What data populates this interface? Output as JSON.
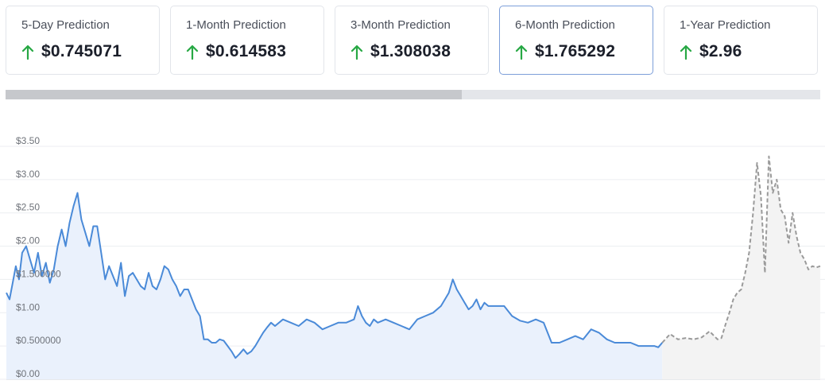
{
  "predictions": [
    {
      "label": "5-Day Prediction",
      "value": "$0.745071",
      "direction": "up",
      "selected": false
    },
    {
      "label": "1-Month Prediction",
      "value": "$0.614583",
      "direction": "up",
      "selected": false
    },
    {
      "label": "3-Month Prediction",
      "value": "$1.308038",
      "direction": "up",
      "selected": false
    },
    {
      "label": "6-Month Prediction",
      "value": "$1.765292",
      "direction": "up",
      "selected": true
    },
    {
      "label": "1-Year Prediction",
      "value": "$2.96",
      "direction": "up",
      "selected": false
    }
  ],
  "colors": {
    "arrow_up": "#27a844",
    "historical_line": "#4a8ad8",
    "historical_fill": "#eaf1fc",
    "forecast_line": "#9a9a9a",
    "forecast_fill": "#f3f3f3",
    "selected_border": "#7d9fd9",
    "grid": "#eceef1"
  },
  "scroll_position": 0.56,
  "chart_data": {
    "type": "area",
    "ylim": [
      0,
      3.5
    ],
    "yticks": [
      {
        "value": 0,
        "label": "$0.00"
      },
      {
        "value": 0.5,
        "label": "$0.500000"
      },
      {
        "value": 1.0,
        "label": "$1.00"
      },
      {
        "value": 1.5,
        "label": "$1.500000"
      },
      {
        "value": 2.0,
        "label": "$2.00"
      },
      {
        "value": 2.5,
        "label": "$2.50"
      },
      {
        "value": 3.0,
        "label": "$3.00"
      },
      {
        "value": 3.5,
        "label": "$3.50"
      }
    ],
    "grid": true,
    "series": [
      {
        "style": "solid",
        "x": [
          0,
          4,
          8,
          12,
          16,
          20,
          25,
          30,
          35,
          40,
          45,
          50,
          55,
          60,
          65,
          70,
          75,
          80,
          85,
          90,
          95,
          100,
          105,
          110,
          115,
          120,
          125,
          130,
          135,
          140,
          145,
          150,
          155,
          160,
          165,
          170,
          175,
          180,
          185,
          190,
          195,
          200,
          205,
          210,
          215,
          220,
          225,
          230,
          235,
          240,
          245,
          250,
          255,
          260,
          265,
          270,
          275,
          280,
          285,
          290,
          295,
          300,
          305,
          310,
          315,
          320,
          325,
          330,
          335,
          340,
          350,
          360,
          370,
          380,
          390,
          400,
          410,
          420,
          430,
          440,
          445,
          450,
          455,
          460,
          465,
          470,
          480,
          490,
          500,
          510,
          520,
          530,
          540,
          550,
          555,
          560,
          565,
          570,
          575,
          580,
          585,
          590,
          595,
          600,
          605,
          610,
          620,
          630,
          640,
          650,
          660,
          670,
          680,
          690,
          700,
          710,
          720,
          730,
          740,
          750,
          760,
          770,
          780,
          790,
          800,
          810,
          820,
          825,
          830
        ],
        "y": [
          1.3,
          1.2,
          1.45,
          1.7,
          1.5,
          1.9,
          2.0,
          1.8,
          1.6,
          1.9,
          1.55,
          1.75,
          1.45,
          1.65,
          2.0,
          2.25,
          2.0,
          2.35,
          2.6,
          2.8,
          2.4,
          2.2,
          2.0,
          2.3,
          2.3,
          1.9,
          1.5,
          1.7,
          1.55,
          1.4,
          1.75,
          1.25,
          1.55,
          1.6,
          1.5,
          1.4,
          1.35,
          1.6,
          1.4,
          1.35,
          1.5,
          1.7,
          1.65,
          1.5,
          1.4,
          1.25,
          1.35,
          1.35,
          1.2,
          1.05,
          0.95,
          0.6,
          0.6,
          0.55,
          0.55,
          0.6,
          0.58,
          0.5,
          0.42,
          0.32,
          0.38,
          0.45,
          0.38,
          0.42,
          0.5,
          0.6,
          0.7,
          0.78,
          0.85,
          0.8,
          0.9,
          0.85,
          0.8,
          0.9,
          0.85,
          0.75,
          0.8,
          0.85,
          0.85,
          0.9,
          1.1,
          0.95,
          0.85,
          0.8,
          0.9,
          0.85,
          0.9,
          0.85,
          0.8,
          0.75,
          0.9,
          0.95,
          1.0,
          1.1,
          1.2,
          1.3,
          1.5,
          1.35,
          1.25,
          1.15,
          1.05,
          1.1,
          1.2,
          1.05,
          1.15,
          1.1,
          1.1,
          1.1,
          0.95,
          0.88,
          0.85,
          0.9,
          0.85,
          0.55,
          0.55,
          0.6,
          0.65,
          0.6,
          0.75,
          0.7,
          0.6,
          0.55,
          0.55,
          0.55,
          0.5,
          0.5,
          0.5,
          0.48,
          0.55
        ]
      },
      {
        "style": "dashed",
        "x": [
          830,
          840,
          850,
          860,
          870,
          880,
          890,
          900,
          905,
          910,
          915,
          920,
          925,
          930,
          935,
          940,
          945,
          950,
          955,
          960,
          965,
          970,
          975,
          980,
          985,
          990,
          995,
          1000,
          1005,
          1010,
          1015,
          1020,
          1025,
          1030
        ],
        "y": [
          0.55,
          0.68,
          0.6,
          0.62,
          0.6,
          0.63,
          0.72,
          0.6,
          0.62,
          0.82,
          1.0,
          1.2,
          1.3,
          1.35,
          1.6,
          1.9,
          2.5,
          3.25,
          2.75,
          1.6,
          3.35,
          2.8,
          3.0,
          2.55,
          2.45,
          2.05,
          2.5,
          2.15,
          1.9,
          1.8,
          1.65,
          1.7,
          1.68,
          1.7
        ]
      }
    ]
  }
}
